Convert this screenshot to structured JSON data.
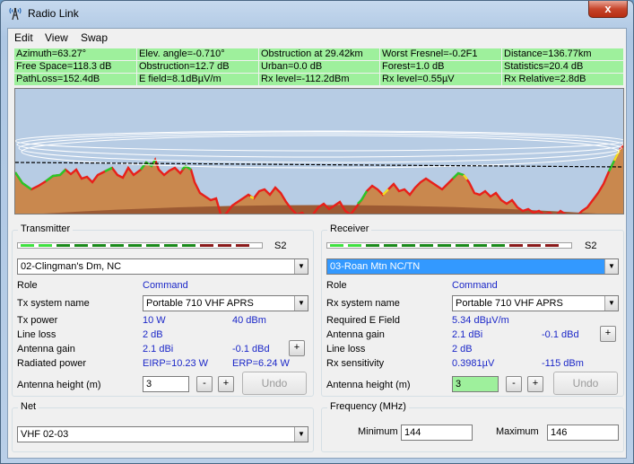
{
  "window": {
    "title": "Radio Link",
    "close_glyph": "x",
    "app_icon": "radio-mast-icon"
  },
  "menu": {
    "items": [
      {
        "label": "Edit"
      },
      {
        "label": "View"
      },
      {
        "label": "Swap"
      }
    ]
  },
  "stats": {
    "rows": [
      [
        "Azimuth=63.27°",
        "Elev. angle=-0.710°",
        "Obstruction at 29.42km",
        "Worst Fresnel=-0.2F1",
        "Distance=136.77km"
      ],
      [
        "Free Space=118.3 dB",
        "Obstruction=12.7 dB",
        "Urban=0.0 dB",
        "Forest=1.0 dB",
        "Statistics=20.4 dB"
      ],
      [
        "PathLoss=152.4dB",
        "E field=8.1dBµV/m",
        "Rx level=-112.2dBm",
        "Rx level=0.55µV",
        "Rx Relative=2.8dB"
      ]
    ],
    "colors": {
      "background": "#9ef09c"
    }
  },
  "profile": {
    "colors": {
      "sky": "#b7cce4",
      "terrain": "#c9884e",
      "earth": "#9c5a33",
      "obstruction": "#e8201a",
      "clear": "#28c828",
      "marginal": "#f0e020",
      "los": "#000000",
      "fresnel": "#ffffff"
    }
  },
  "transmitter": {
    "title": "Transmitter",
    "meter_label": "S2",
    "meter_segments": [
      "#3fe03f",
      "#3fe03f",
      "#1a8a1a",
      "#1a8a1a",
      "#1a8a1a",
      "#1a8a1a",
      "#1a8a1a",
      "#1a8a1a",
      "#1a8a1a",
      "#1a8a1a",
      "#8a1a1a",
      "#8a1a1a",
      "#8a1a1a"
    ],
    "site": "02-Clingman's Dm, NC",
    "role_label": "Role",
    "role_value": "Command",
    "system_label": "Tx system name",
    "system_value": "Portable 710 VHF APRS",
    "power_label": "Tx power",
    "power_w": "10 W",
    "power_dbm": "40 dBm",
    "line_loss_label": "Line loss",
    "line_loss_value": "2 dB",
    "gain_label": "Antenna gain",
    "gain_dbi": "2.1 dBi",
    "gain_dbd": "-0.1 dBd",
    "radiated_label": "Radiated power",
    "eirp": "EIRP=10.23 W",
    "erp": "ERP=6.24 W",
    "height_label": "Antenna height (m)",
    "height_value": "3",
    "plus": "+",
    "minus": "-",
    "undo": "Undo"
  },
  "receiver": {
    "title": "Receiver",
    "meter_label": "S2",
    "meter_segments": [
      "#3fe03f",
      "#3fe03f",
      "#1a8a1a",
      "#1a8a1a",
      "#1a8a1a",
      "#1a8a1a",
      "#1a8a1a",
      "#1a8a1a",
      "#1a8a1a",
      "#1a8a1a",
      "#8a1a1a",
      "#8a1a1a",
      "#8a1a1a"
    ],
    "site": "03-Roan Mtn NC/TN",
    "role_label": "Role",
    "role_value": "Command",
    "system_label": "Rx system name",
    "system_value": "Portable 710 VHF APRS",
    "efield_label": "Required E Field",
    "efield_value": "5.34 dBµV/m",
    "gain_label": "Antenna gain",
    "gain_dbi": "2.1 dBi",
    "gain_dbd": "-0.1 dBd",
    "line_loss_label": "Line loss",
    "line_loss_value": "2 dB",
    "sens_label": "Rx sensitivity",
    "sens_uv": "0.3981µV",
    "sens_dbm": "-115 dBm",
    "height_label": "Antenna height (m)",
    "height_value": "3",
    "plus": "+",
    "minus": "-",
    "undo": "Undo"
  },
  "net": {
    "title": "Net",
    "value": "VHF 02-03"
  },
  "frequency": {
    "title": "Frequency (MHz)",
    "min_label": "Minimum",
    "min_value": "144",
    "max_label": "Maximum",
    "max_value": "146"
  }
}
